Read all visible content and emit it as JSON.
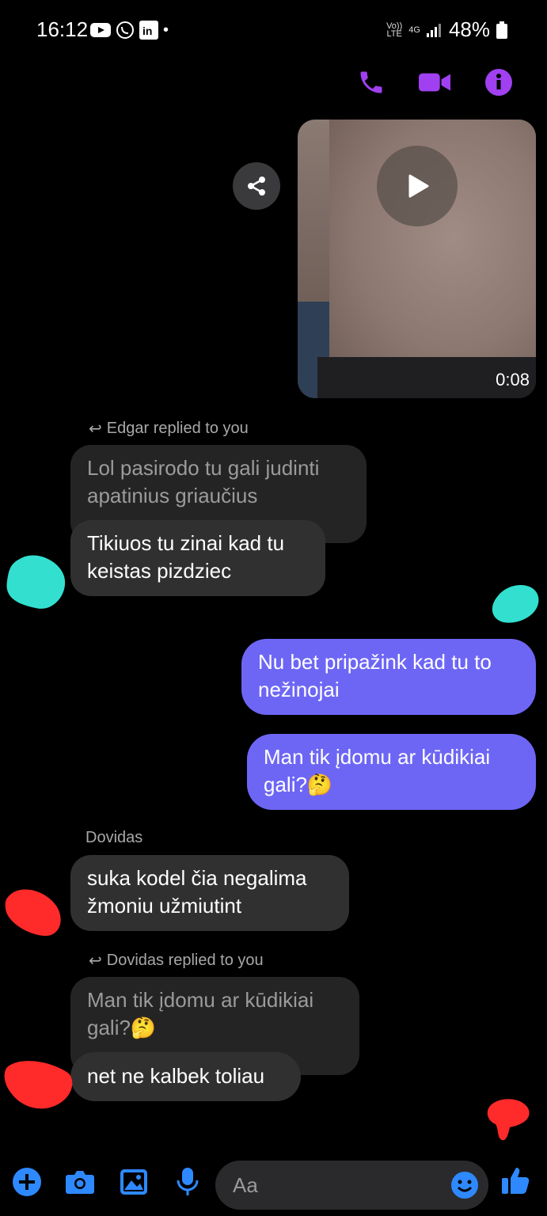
{
  "status_bar": {
    "time": "16:12",
    "volte": "Vo))\nLTE",
    "network": "4G",
    "battery": "48%"
  },
  "header": {
    "icons": [
      "phone-icon",
      "video-call-icon",
      "info-icon"
    ],
    "accent": "#a040f0"
  },
  "video_message": {
    "duration": "0:08"
  },
  "messages": {
    "reply1_note": "Edgar replied to you",
    "reply1_quoted": "Lol pasirodo tu gali judinti apatinius griaučius",
    "reply1_text": "Tikiuos tu zinai kad tu keistas pizdziec",
    "out1": "Nu bet pripažink kad tu to nežinojai",
    "out2": "Man tik įdomu ar kūdikiai gali?🤔",
    "sender2": "Dovidas",
    "in2": "suka kodel čia negalima žmoniu užmiutint",
    "reply2_note": "Dovidas replied to you",
    "reply2_quoted": "Man tik įdomu ar kūdikiai gali?🤔",
    "reply2_text": "net ne kalbek toliau"
  },
  "composer": {
    "placeholder": "Aa"
  },
  "colors": {
    "outgoing": "#6d66f5",
    "incoming": "#303030",
    "accent": "#a040f0",
    "bar_icons": "#2e89ff"
  }
}
